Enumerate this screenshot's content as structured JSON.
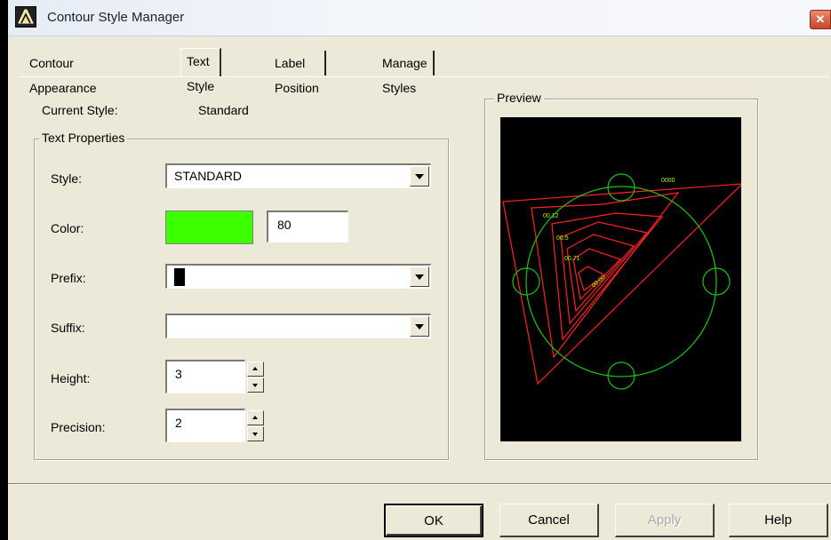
{
  "window": {
    "title": "Contour Style Manager",
    "close_glyph": "✕"
  },
  "tabs": [
    {
      "label": "Contour Appearance"
    },
    {
      "label": "Text Style"
    },
    {
      "label": "Label Position"
    },
    {
      "label": "Manage Styles"
    }
  ],
  "current_style": {
    "label": "Current Style:",
    "value": "Standard"
  },
  "text_properties": {
    "group_title": "Text Properties",
    "style": {
      "label": "Style:",
      "value": "STANDARD"
    },
    "color": {
      "label": "Color:",
      "swatch": "#3cff00",
      "value": "80"
    },
    "prefix": {
      "label": "Prefix:",
      "value": ""
    },
    "suffix": {
      "label": "Suffix:",
      "value": ""
    },
    "height": {
      "label": "Height:",
      "value": "3"
    },
    "precision": {
      "label": "Precision:",
      "value": "2"
    }
  },
  "preview": {
    "group_title": "Preview",
    "labels": [
      "0000",
      "00.12",
      "00.5",
      "00.71",
      "00.00"
    ],
    "colors": {
      "background": "#000000",
      "contour": "#ff2020",
      "circle": "#19c419",
      "text": "#aaff00"
    }
  },
  "buttons": {
    "ok": "OK",
    "cancel": "Cancel",
    "apply": "Apply",
    "help": "Help"
  }
}
